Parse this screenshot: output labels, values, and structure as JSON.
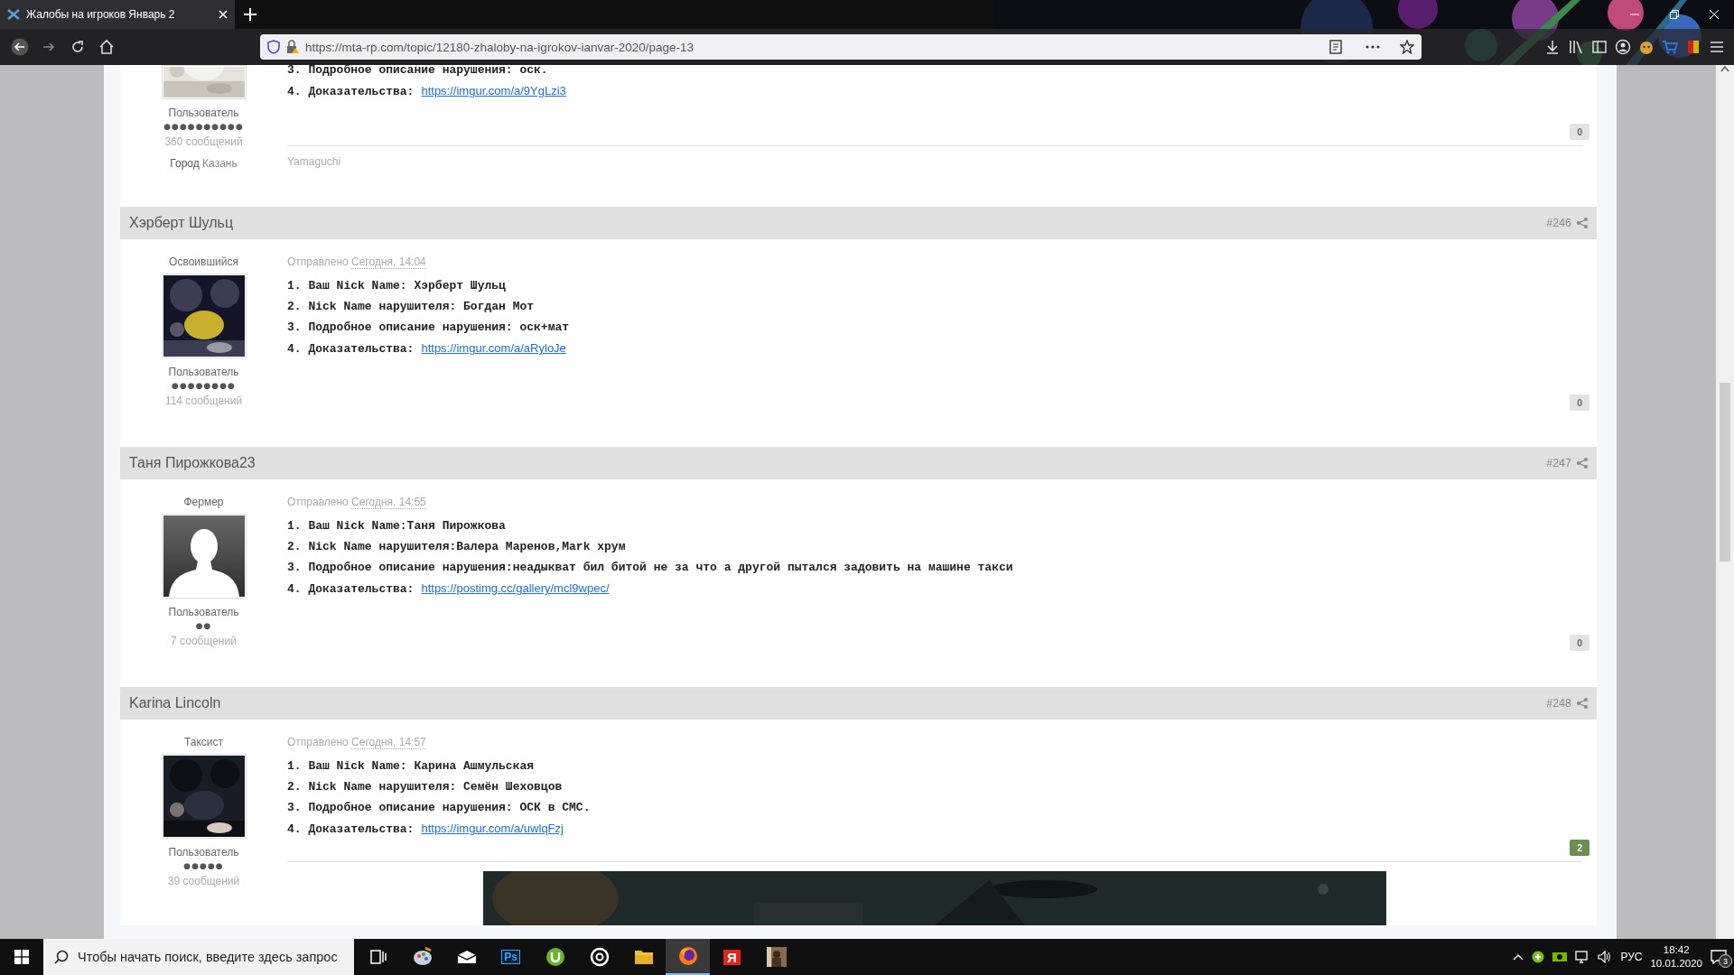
{
  "browser": {
    "tab": {
      "title": "Жалобы на игроков Январь 2",
      "selected": true
    },
    "url": "https://mta-rp.com/topic/12180-zhaloby-na-igrokov-ianvar-2020/page-13"
  },
  "posts": [
    {
      "group": "Пользователь",
      "pips": "●●●●●●●●●●",
      "post_count": "360 сообщений",
      "city_label": "Город",
      "city": "Казань",
      "lines": [
        {
          "text": "3. Подробное описание нарушения: оск."
        },
        {
          "text": "4. Доказательства:",
          "link": "https://imgur.com/a/9YgLzi3"
        }
      ],
      "reputation": {
        "value": "0",
        "positive": false
      },
      "signature": {
        "kind": "text",
        "text": "Yamaguchi"
      }
    },
    {
      "author": "Хэрберт Шульц",
      "number": "#246",
      "rank_title": "Освоившийся",
      "group": "Пользователь",
      "pips": "●●●●●●●●",
      "post_count": "114 сообщений",
      "posted_label": "Отправлено",
      "date": "Сегодня, 14:04",
      "lines": [
        {
          "text": "1. Ваш Nick Name: Хэрберт Шульц"
        },
        {
          "text": "2. Nick Name нарушителя: Богдан Мот"
        },
        {
          "text": "3. Подробное описание нарушения: оск+мат"
        },
        {
          "text": "4. Доказательства:",
          "link": "https://imgur.com/a/aRyloJe"
        }
      ],
      "reputation": {
        "value": "0",
        "positive": false
      }
    },
    {
      "author": "Таня Пирожкова23",
      "number": "#247",
      "rank_title": "Фермер",
      "avatar": {
        "kind": "silhouette"
      },
      "group": "Пользователь",
      "pips": "●●",
      "post_count": "7 сообщений",
      "posted_label": "Отправлено",
      "date": "Сегодня, 14:55",
      "lines": [
        {
          "text": "1. Ваш Nick Name:Таня Пирожкова"
        },
        {
          "text": "2. Nick Name нарушителя:Валера Маренов,Mark хрум"
        },
        {
          "text": "3. Подробное описание нарушения:неадыкват бил битой не за что а другой пытался задовить на машине такси"
        },
        {
          "text": "4. Доказательства:",
          "link": "https://postimg.cc/gallery/mcl9wpec/"
        }
      ],
      "reputation": {
        "value": "0",
        "positive": false
      }
    },
    {
      "author": "Karina Lincoln",
      "number": "#248",
      "rank_title": "Таксист",
      "group": "Пользователь",
      "pips": "●●●●●",
      "post_count": "39 сообщений",
      "posted_label": "Отправлено",
      "date": "Сегодня, 14:57",
      "lines": [
        {
          "text": "1. Ваш Nick Name: Карина Ашмульская"
        },
        {
          "text": "2. Nick Name нарушителя: Семён Шеховцов"
        },
        {
          "text": "3. Подробное описание нарушения: ОСК в СМС."
        },
        {
          "text": "4. Доказательства:",
          "link": "https://imgur.com/a/uwlqFzj"
        }
      ],
      "reputation": {
        "value": "2",
        "positive": true
      }
    }
  ],
  "taskbar": {
    "search": {
      "placeholder": "Чтобы начать поиск, введите здесь запрос"
    },
    "apps": [
      {
        "kind": "taskview",
        "selected": false
      },
      {
        "kind": "paint",
        "selected": false
      },
      {
        "kind": "mail",
        "selected": false
      },
      {
        "kind": "text",
        "label": "Ps",
        "selected": false
      },
      {
        "kind": "torrent",
        "selected": false
      },
      {
        "kind": "ring",
        "selected": false
      },
      {
        "kind": "folder",
        "selected": false
      },
      {
        "kind": "firefox",
        "selected": true
      },
      {
        "kind": "text",
        "label": "Я",
        "selected": false
      },
      {
        "kind": "game",
        "selected": false
      }
    ],
    "language": "РУС",
    "time": "18:42",
    "date": "10.01.2020",
    "notifications": "3"
  }
}
